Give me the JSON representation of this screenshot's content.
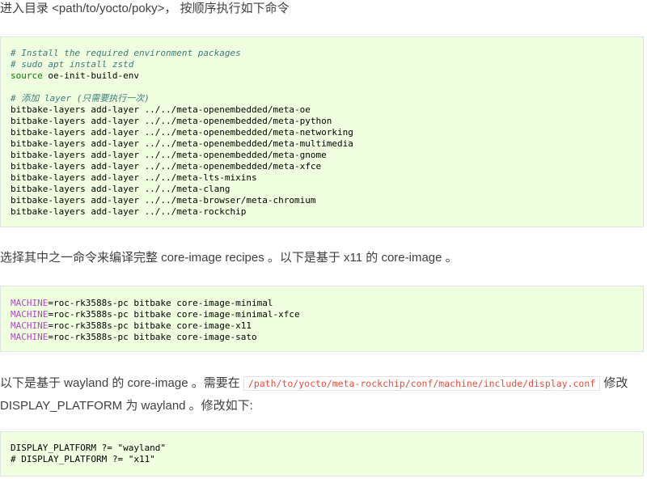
{
  "para1": {
    "text": "进入目录 <path/to/yocto/poky>， 按顺序执行如下命令"
  },
  "block1": {
    "lines": [
      {
        "type": "comment",
        "text": "# Install the required environment packages"
      },
      {
        "type": "comment",
        "text": "# sudo apt install zstd"
      },
      {
        "type": "source",
        "kw": "source",
        "rest": " oe-init-build-env"
      },
      {
        "type": "blank"
      },
      {
        "type": "comment",
        "text": "# 添加 layer (只需要执行一次)"
      },
      {
        "type": "plain",
        "text": "bitbake-layers add-layer ../../meta-openembedded/meta-oe"
      },
      {
        "type": "plain",
        "text": "bitbake-layers add-layer ../../meta-openembedded/meta-python"
      },
      {
        "type": "plain",
        "text": "bitbake-layers add-layer ../../meta-openembedded/meta-networking"
      },
      {
        "type": "plain",
        "text": "bitbake-layers add-layer ../../meta-openembedded/meta-multimedia"
      },
      {
        "type": "plain",
        "text": "bitbake-layers add-layer ../../meta-openembedded/meta-gnome"
      },
      {
        "type": "plain",
        "text": "bitbake-layers add-layer ../../meta-openembedded/meta-xfce"
      },
      {
        "type": "plain",
        "text": "bitbake-layers add-layer ../../meta-lts-mixins"
      },
      {
        "type": "plain",
        "text": "bitbake-layers add-layer ../../meta-clang"
      },
      {
        "type": "plain",
        "text": "bitbake-layers add-layer ../../meta-browser/meta-chromium"
      },
      {
        "type": "plain",
        "text": "bitbake-layers add-layer ../../meta-rockchip"
      }
    ]
  },
  "para2": {
    "text": "选择其中之一命令来编译完整 core-image recipes 。以下是基于 x11 的 core-image 。"
  },
  "block2": {
    "var": "MACHINE",
    "lines": [
      "=roc-rk3588s-pc bitbake core-image-minimal",
      "=roc-rk3588s-pc bitbake core-image-minimal-xfce",
      "=roc-rk3588s-pc bitbake core-image-x11",
      "=roc-rk3588s-pc bitbake core-image-sato"
    ]
  },
  "para3": {
    "before": "以下是基于 wayland 的 core-image 。需要在 ",
    "code": "/path/to/yocto/meta-rockchip/conf/machine/include/display.conf",
    "after": " 修改 DISPLAY_PLATFORM 为 wayland 。修改如下:"
  },
  "block3": {
    "lines": [
      "DISPLAY_PLATFORM ?= \"wayland\"",
      "# DISPLAY_PLATFORM ?= \"x11\""
    ]
  },
  "colors": {
    "code_bg": "#efffdf",
    "comment": "#3d7b7b",
    "keyword": "#008000",
    "variable": "#b048c8",
    "inline_code": "#e74c3c"
  }
}
